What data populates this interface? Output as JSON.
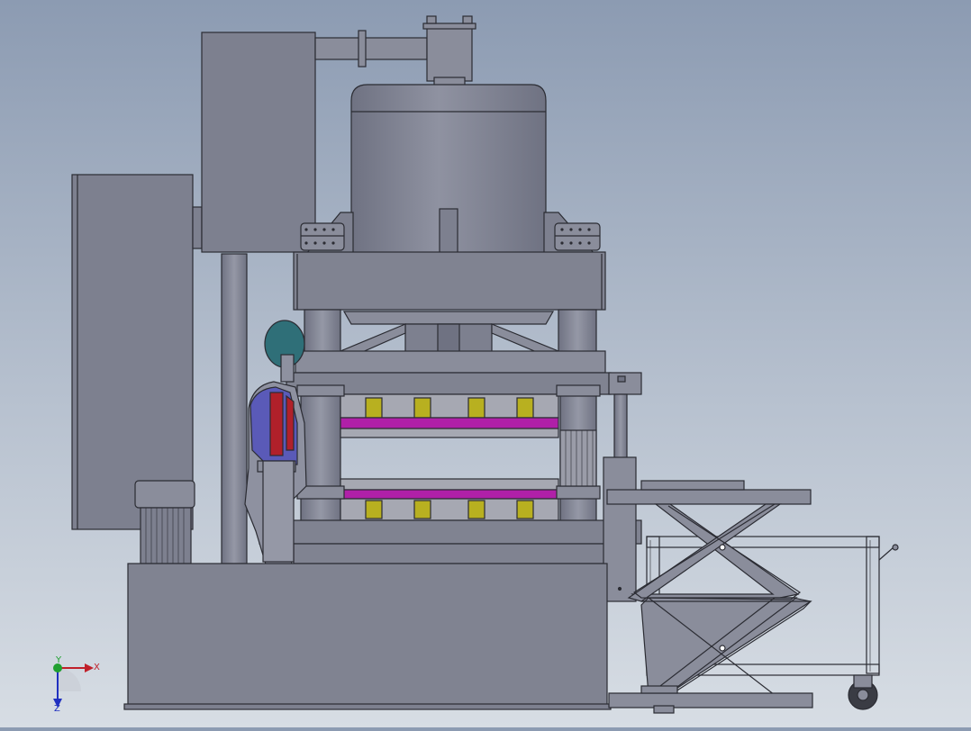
{
  "triad": {
    "x_label": "X",
    "y_label": "Y",
    "z_label": "Z"
  },
  "colors": {
    "background_top": "#8c9bb2",
    "background_bottom": "#d7dde4",
    "steel": "#7d808f",
    "steel_light": "#8a8d9b",
    "outline": "#2b2c33",
    "heating_plate": "#b020a8",
    "mold_block": "#b8b020",
    "operator_torso": "#5a5ab8",
    "operator_stripe": "#b0202a",
    "operator_head": "#2f6f78"
  }
}
